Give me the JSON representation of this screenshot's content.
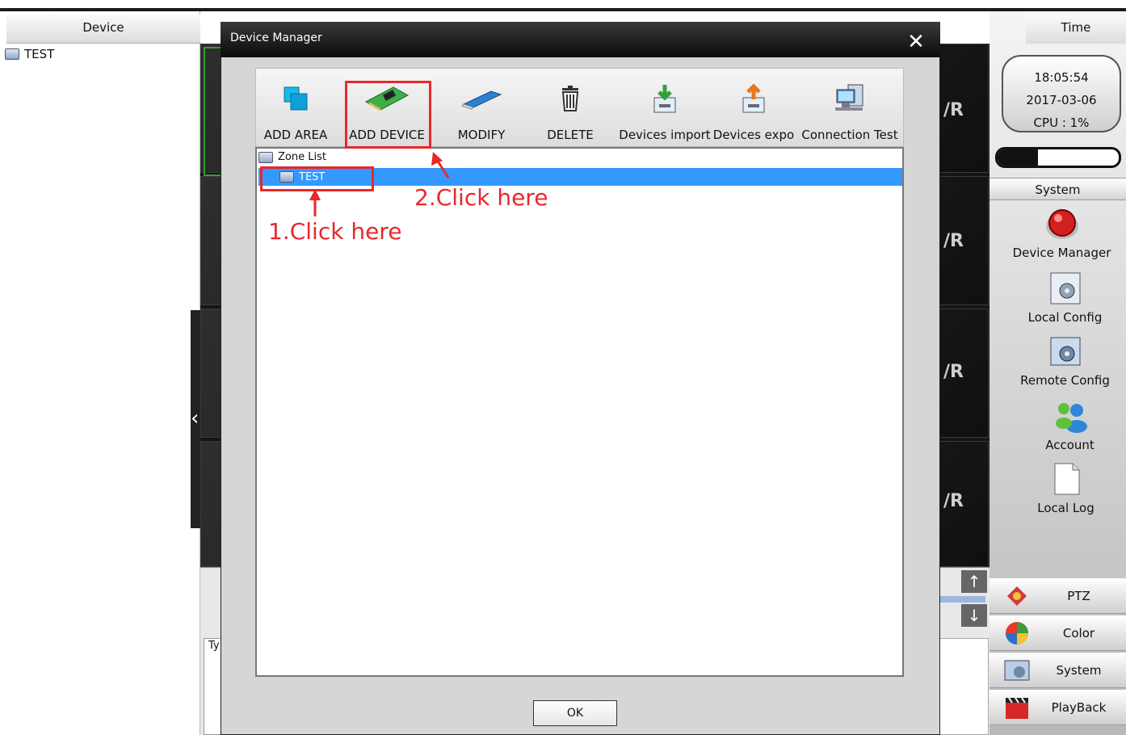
{
  "left_panel": {
    "header": "Device",
    "tree_item": "TEST"
  },
  "right_panel": {
    "header": "Time",
    "clock": {
      "time": "18:05:54",
      "date": "2017-03-06",
      "cpu": "CPU : 1%"
    },
    "cpu_level_percent": 1,
    "system_tab": "System",
    "system_items": [
      {
        "label": "Device Manager",
        "icon": "device-manager-icon"
      },
      {
        "label": "Local Config",
        "icon": "local-config-icon"
      },
      {
        "label": "Remote Config",
        "icon": "remote-config-icon"
      },
      {
        "label": "Account",
        "icon": "account-icon"
      },
      {
        "label": "Local Log",
        "icon": "local-log-icon"
      }
    ],
    "bottom_menu": [
      {
        "label": "PTZ",
        "icon": "ptz-icon"
      },
      {
        "label": "Color",
        "icon": "color-icon"
      },
      {
        "label": "System",
        "icon": "system-icon"
      },
      {
        "label": "PlayBack",
        "icon": "playback-icon"
      }
    ]
  },
  "video_grid": {
    "logo_text": "/R"
  },
  "bottom_log": {
    "column_header": "Ty"
  },
  "dialog": {
    "title": "Device Manager",
    "close_symbol": "✕",
    "toolbar": [
      {
        "label": "ADD AREA",
        "icon": "add-area-icon"
      },
      {
        "label": "ADD DEVICE",
        "icon": "add-device-icon"
      },
      {
        "label": "MODIFY",
        "icon": "modify-icon"
      },
      {
        "label": "DELETE",
        "icon": "trash-icon"
      },
      {
        "label": "Devices import",
        "icon": "import-icon"
      },
      {
        "label": "Devices expo",
        "icon": "export-icon"
      },
      {
        "label": "Connection  Test",
        "icon": "connection-test-icon"
      }
    ],
    "tree": {
      "root": "Zone List",
      "selected_item": "TEST"
    },
    "ok_label": "OK"
  },
  "annotations": {
    "step1": "1.Click here",
    "step2": "2.Click here",
    "color": "#e8282c"
  },
  "colors": {
    "selection": "#3399ff",
    "annotation": "#e8282c"
  }
}
